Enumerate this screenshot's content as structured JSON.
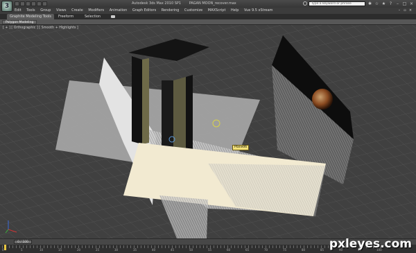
{
  "window": {
    "title_parts": [
      "Autodesk 3ds Max 2010 SP1",
      "PAGAN MOON_recover.max"
    ],
    "search_placeholder": "Type a keyword or phrase"
  },
  "menu": {
    "items": [
      "Edit",
      "Tools",
      "Group",
      "Views",
      "Create",
      "Modifiers",
      "Animation",
      "Graph Editors",
      "Rendering",
      "Customize",
      "MAXScript",
      "Help",
      "Vue 9.5 xStream"
    ]
  },
  "ribbon": {
    "tabs": [
      "Graphite Modeling Tools",
      "Freeform",
      "Selection"
    ],
    "active_tab": "Graphite Modeling Tools",
    "group_label": "Polygon Modeling"
  },
  "viewport": {
    "label": "[ + ] [ Orthographic ] [ Smooth + Highlights ]",
    "object_tooltip": "Plane06"
  },
  "timeline": {
    "slider_text": "0 / 100",
    "track_labels": [
      "0",
      "5",
      "10",
      "15",
      "20",
      "25",
      "30",
      "35",
      "40",
      "45",
      "50",
      "55",
      "60",
      "65",
      "70",
      "75",
      "80",
      "85",
      "90",
      "95",
      "100"
    ]
  },
  "watermark": "pxleyes.com"
}
